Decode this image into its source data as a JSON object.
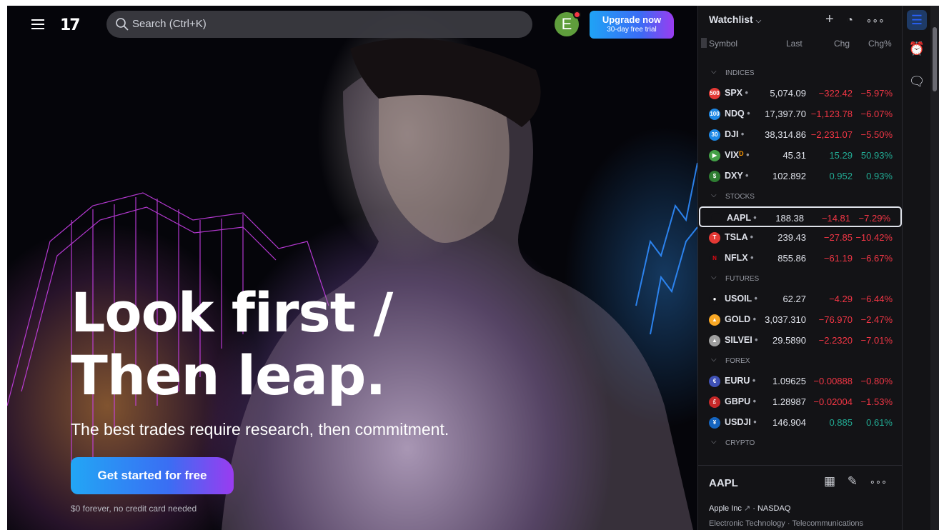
{
  "header": {
    "logo_text": "17",
    "search_placeholder": "Search (Ctrl+K)",
    "avatar_letter": "E",
    "upgrade_title": "Upgrade now",
    "upgrade_subtitle": "30-day free trial"
  },
  "hero": {
    "headline_line1": "Look first /",
    "headline_line2": "Then leap.",
    "subline": "The best trades require research, then commitment.",
    "cta_label": "Get started for free",
    "cta_note": "$0 forever, no credit card needed"
  },
  "watchlist": {
    "title": "Watchlist",
    "columns": {
      "symbol": "Symbol",
      "last": "Last",
      "chg": "Chg",
      "pct": "Chg%"
    },
    "sections": [
      {
        "name": "INDICES",
        "rows": [
          {
            "icon": "500",
            "icon_color": "#e53935",
            "symbol": "SPX",
            "last": "5,074.09",
            "chg": "−322.42",
            "pct": "−5.97%",
            "dir": "neg"
          },
          {
            "icon": "100",
            "icon_color": "#1e88e5",
            "symbol": "NDQ",
            "last": "17,397.70",
            "chg": "−1,123.78",
            "pct": "−6.07%",
            "dir": "neg"
          },
          {
            "icon": "30",
            "icon_color": "#1e88e5",
            "symbol": "DJI",
            "last": "38,314.86",
            "chg": "−2,231.07",
            "pct": "−5.50%",
            "dir": "neg"
          },
          {
            "icon": "▶",
            "icon_color": "#43a047",
            "symbol": "VIX",
            "flag": "D",
            "last": "45.31",
            "chg": "15.29",
            "pct": "50.93%",
            "dir": "pos"
          },
          {
            "icon": "$",
            "icon_color": "#2e7d32",
            "symbol": "DXY",
            "last": "102.892",
            "chg": "0.952",
            "pct": "0.93%",
            "dir": "pos"
          }
        ]
      },
      {
        "name": "STOCKS",
        "rows": [
          {
            "icon": "",
            "icon_color": "#131316",
            "symbol": "AAPL",
            "last": "188.38",
            "chg": "−14.81",
            "pct": "−7.29%",
            "dir": "neg",
            "selected": true
          },
          {
            "icon": "T",
            "icon_color": "#e53935",
            "symbol": "TSLA",
            "last": "239.43",
            "chg": "−27.85",
            "pct": "−10.42%",
            "dir": "neg"
          },
          {
            "icon": "N",
            "icon_color": "#131316",
            "icon_text_color": "#e50914",
            "symbol": "NFLX",
            "last": "855.86",
            "chg": "−61.19",
            "pct": "−6.67%",
            "dir": "neg"
          }
        ]
      },
      {
        "name": "FUTURES",
        "rows": [
          {
            "icon": "●",
            "icon_color": "#131316",
            "symbol": "USOIL",
            "last": "62.27",
            "chg": "−4.29",
            "pct": "−6.44%",
            "dir": "neg"
          },
          {
            "icon": "▲",
            "icon_color": "#f9a825",
            "symbol": "GOLD",
            "last": "3,037.310",
            "chg": "−76.970",
            "pct": "−2.47%",
            "dir": "neg"
          },
          {
            "icon": "▲",
            "icon_color": "#9e9e9e",
            "symbol": "SILVEI",
            "last": "29.5890",
            "chg": "−2.2320",
            "pct": "−7.01%",
            "dir": "neg"
          }
        ]
      },
      {
        "name": "FOREX",
        "rows": [
          {
            "icon": "€",
            "icon_color": "#3f51b5",
            "symbol": "EURU",
            "last": "1.09625",
            "chg": "−0.00888",
            "pct": "−0.80%",
            "dir": "neg"
          },
          {
            "icon": "£",
            "icon_color": "#c62828",
            "symbol": "GBPU",
            "last": "1.28987",
            "chg": "−0.02004",
            "pct": "−1.53%",
            "dir": "neg"
          },
          {
            "icon": "¥",
            "icon_color": "#1565c0",
            "symbol": "USDJI",
            "last": "146.904",
            "chg": "0.885",
            "pct": "0.61%",
            "dir": "pos"
          }
        ]
      },
      {
        "name": "CRYPTO",
        "rows": []
      }
    ],
    "detail": {
      "symbol": "AAPL",
      "company": "Apple Inc",
      "exchange": "NASDAQ",
      "sector": "Electronic Technology",
      "industry": "Telecommunications Equipment"
    }
  },
  "icons": {
    "hamburger": "menu-icon",
    "search": "search-icon",
    "add": "plus-icon",
    "chart": "pie-chart-icon",
    "more": "more-dots-icon",
    "watchlist": "watchlist-icon",
    "alarm": "alarm-clock-icon",
    "chat": "chat-icon"
  }
}
